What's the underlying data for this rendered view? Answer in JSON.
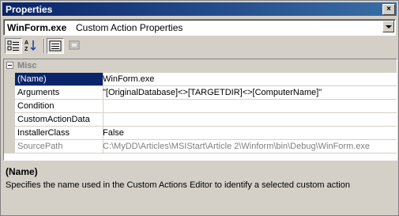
{
  "window": {
    "title": "Properties",
    "close_label": "×"
  },
  "object_selector": {
    "name": "WinForm.exe",
    "type": "Custom Action Properties"
  },
  "toolbar": {
    "buttons": [
      "categorized-view",
      "alphabetical-view",
      "properties",
      "property-pages"
    ]
  },
  "grid": {
    "category": "Misc",
    "rows": [
      {
        "name": "(Name)",
        "value": "WinForm.exe"
      },
      {
        "name": "Arguments",
        "value": "\"[OriginalDatabase]<>[TARGETDIR]<>[ComputerName]\""
      },
      {
        "name": "Condition",
        "value": ""
      },
      {
        "name": "CustomActionData",
        "value": ""
      },
      {
        "name": "InstallerClass",
        "value": "False"
      },
      {
        "name": "SourcePath",
        "value": "C:\\MyDD\\Articles\\MSIStart\\Article 2\\Winform\\bin\\Debug\\WinForm.exe"
      }
    ]
  },
  "description": {
    "name": "(Name)",
    "text": "Specifies the name used in the Custom Actions Editor to identify a selected custom action"
  }
}
